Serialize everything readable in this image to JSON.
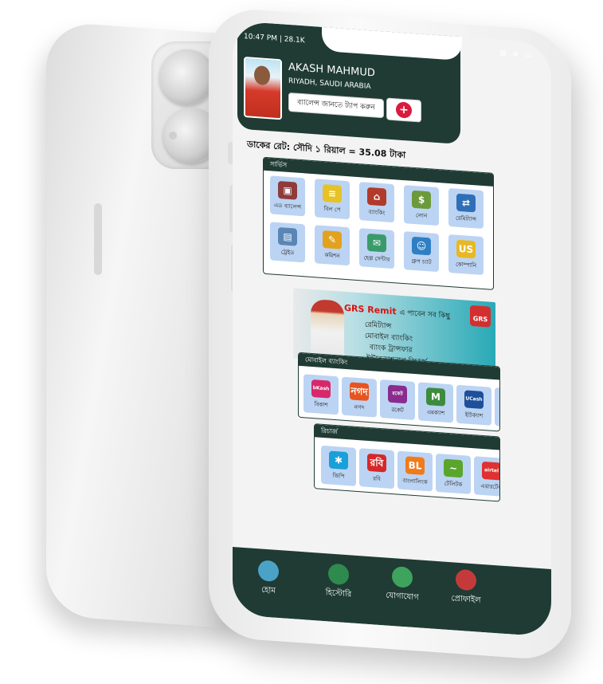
{
  "status_bar": {
    "time": "10:47 PM | 28.1K",
    "icons": "⊠ ≋ ▭"
  },
  "user": {
    "name": "AKASH MAHMUD",
    "location": "RIYADH, SAUDI ARABIA",
    "balance_button": "ব্যালেন্স জানতে ট্যাপ করুন",
    "plus_label": "+"
  },
  "rate_text": "ডাকের রেট: সৌদি ১ রিয়াল = 35.08 টাকা",
  "services": {
    "title": "সার্ভিস",
    "items": [
      {
        "label": "এড ব্যালেন্স",
        "icon": "wallet-icon",
        "glyph": "▣",
        "color": "#8e3b3b"
      },
      {
        "label": "বিল পে",
        "icon": "bill-icon",
        "glyph": "≡",
        "color": "#e6c229"
      },
      {
        "label": "ব্যাংকিং",
        "icon": "bank-icon",
        "glyph": "⌂",
        "color": "#b23a2a"
      },
      {
        "label": "লোন",
        "icon": "loan-icon",
        "glyph": "$",
        "color": "#6c9a3a"
      },
      {
        "label": "রেমিট্যান্স",
        "icon": "remittance-icon",
        "glyph": "⇄",
        "color": "#2e6fb7"
      },
      {
        "label": "ট্রেইড",
        "icon": "trade-icon",
        "glyph": "▤",
        "color": "#5a86b5"
      },
      {
        "label": "কমিশন",
        "icon": "commission-icon",
        "glyph": "✎",
        "color": "#e2a21e"
      },
      {
        "label": "হেল্প সেন্টার",
        "icon": "help-icon",
        "glyph": "✉",
        "color": "#3a9b6a"
      },
      {
        "label": "গ্রুপ চ্যাট",
        "icon": "group-chat-icon",
        "glyph": "☺",
        "color": "#2f7fc4"
      },
      {
        "label": "কোম্পানি",
        "icon": "about-us-icon",
        "glyph": "US",
        "color": "#e8b823"
      }
    ]
  },
  "banner": {
    "headline": "GRS Remit",
    "headline_tail": "এ পাবেন সব কিছু",
    "lines": [
      "রেমিট্যান্স",
      "মোবাইল ব্যাংকিং",
      "ব্যাংক ট্রান্সফার",
      "ইন্টারন্যাশনাল রিচার্জ"
    ],
    "logo": "GRS"
  },
  "mobile_banking": {
    "title": "মোবাইল ব্যাংকিং",
    "items": [
      {
        "label": "বিকাশ",
        "icon": "bkash-icon",
        "glyph": "bKash",
        "color": "#d6286b"
      },
      {
        "label": "নগদ",
        "icon": "nagad-icon",
        "glyph": "নগদ",
        "color": "#e8541f"
      },
      {
        "label": "রকেট",
        "icon": "rocket-icon",
        "glyph": "রকেট",
        "color": "#8a2b8e"
      },
      {
        "label": "এমক্যাশ",
        "icon": "mcash-icon",
        "glyph": "M",
        "color": "#3d8b3d"
      },
      {
        "label": "ইউক্যাশ",
        "icon": "ucash-icon",
        "glyph": "UCash",
        "color": "#1d4f9b"
      },
      {
        "label": "শি",
        "icon": "sure-cash-icon",
        "glyph": "S",
        "color": "#e6a521"
      }
    ]
  },
  "recharge": {
    "title": "রিচার্জ",
    "items": [
      {
        "label": "জিপি",
        "icon": "grameenphone-icon",
        "glyph": "✱",
        "color": "#1aa0d8"
      },
      {
        "label": "রবি",
        "icon": "robi-icon",
        "glyph": "রবি",
        "color": "#d62828"
      },
      {
        "label": "বাংলালিংক",
        "icon": "banglalink-icon",
        "glyph": "BL",
        "color": "#f07b1a"
      },
      {
        "label": "টেলিটক",
        "icon": "teletalk-icon",
        "glyph": "~",
        "color": "#5aa52c"
      },
      {
        "label": "এয়ারটেল",
        "icon": "airtel-icon",
        "glyph": "airtel",
        "color": "#e03131"
      }
    ]
  },
  "nav": [
    {
      "label": "হোম",
      "icon": "home-icon",
      "color": "#4aa3c7"
    },
    {
      "label": "হিস্টোরি",
      "icon": "history-icon",
      "color": "#2e8a4d"
    },
    {
      "label": "যোগাযোগ",
      "icon": "chat-icon",
      "color": "#3da35d"
    },
    {
      "label": "প্রোফাইল",
      "icon": "profile-icon",
      "color": "#c43a3a"
    }
  ]
}
